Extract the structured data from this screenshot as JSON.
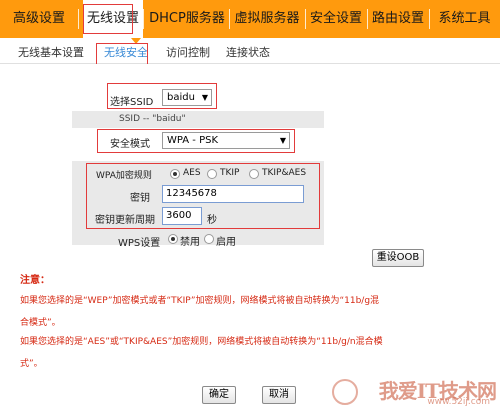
{
  "top_menu": {
    "items": [
      {
        "label": "高级设置"
      },
      {
        "label": "无线设置"
      },
      {
        "label": "DHCP服务器"
      },
      {
        "label": "虚拟服务器"
      },
      {
        "label": "安全设置"
      },
      {
        "label": "路由设置"
      },
      {
        "label": "系统工具"
      }
    ],
    "active_index": 1
  },
  "sub_menu": {
    "items": [
      {
        "label": "无线基本设置"
      },
      {
        "label": "无线安全"
      },
      {
        "label": "访问控制"
      },
      {
        "label": "连接状态"
      }
    ],
    "active_index": 1
  },
  "form": {
    "ssid_label": "选择SSID",
    "ssid_value": "baidu",
    "ssid_info": "SSID -- \"baidu\"",
    "security_mode_label": "安全模式",
    "security_mode_value": "WPA - PSK",
    "wpa_cipher_label": "WPA加密规则",
    "wpa_options": [
      "AES",
      "TKIP",
      "TKIP&AES"
    ],
    "wpa_selected": "AES",
    "key_label": "密钥",
    "key_value": "12345678",
    "key_renewal_label": "密钥更新周期",
    "key_renewal_value": "3600",
    "key_renewal_unit": "秒",
    "wps_label": "WPS设置",
    "wps_options": [
      "禁用",
      "启用"
    ],
    "wps_selected": "禁用",
    "reset_oob_label": "重设OOB"
  },
  "notes": {
    "title": "注意：",
    "line1": "如果您选择的是“WEP”加密模式或者“TKIP”加密规则，网络模式将被自动转换为“11b/g混",
    "line2": "合模式”。",
    "line3": "如果您选择的是“AES”或“TKIP&AES”加密规则，网络模式将被自动转换为“11b/g/n混合模",
    "line4": "式”。"
  },
  "buttons": {
    "confirm": "确定",
    "cancel": "取消"
  },
  "watermark": {
    "text": "我爱IT技术网",
    "url": "www.52ij.com"
  },
  "colors": {
    "menu_bg": "#ff9a0d",
    "active_sub": "#3a8ad6",
    "annotation_red": "#e23b3b",
    "note_red": "#d62a14"
  }
}
